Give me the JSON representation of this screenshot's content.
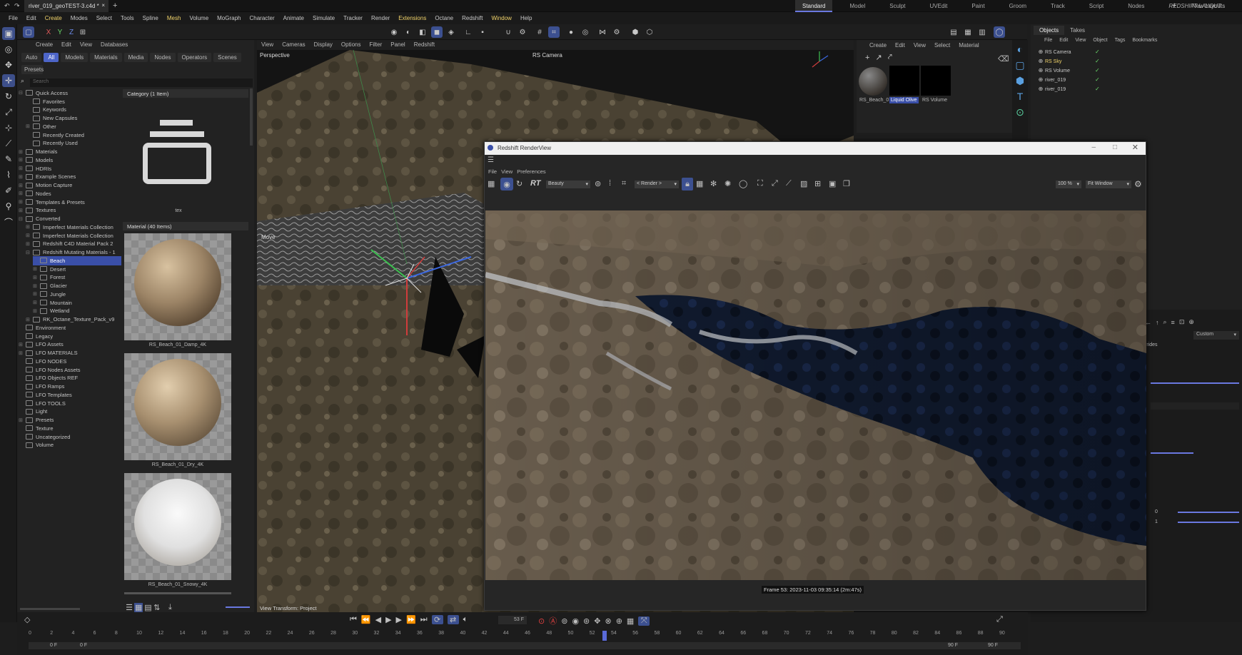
{
  "titlebar": {
    "tab": "river_019_geoTEST-3.c4d *",
    "layouts": [
      "Standard",
      "Model",
      "Sculpt",
      "UVEdit",
      "Paint",
      "Groom",
      "Track",
      "Script",
      "Nodes",
      "REDSHIFT-LAYOUT"
    ],
    "new_layouts": "New Layouts"
  },
  "menu": [
    "File",
    "Edit",
    "Create",
    "Modes",
    "Select",
    "Tools",
    "Spline",
    "Mesh",
    "Volume",
    "MoGraph",
    "Character",
    "Animate",
    "Simulate",
    "Tracker",
    "Render",
    "Extensions",
    "Octane",
    "Redshift",
    "Window",
    "Help"
  ],
  "asset": {
    "menu": [
      "Create",
      "Edit",
      "View",
      "Databases"
    ],
    "filters": [
      "Auto",
      "All",
      "Models",
      "Materials",
      "Media",
      "Nodes",
      "Operators",
      "Scenes"
    ],
    "presets": "Presets",
    "search": "Search",
    "tree": [
      {
        "l": "Quick Access",
        "d": 0,
        "f": "-"
      },
      {
        "l": "Favorites",
        "d": 1
      },
      {
        "l": "Keywords",
        "d": 1
      },
      {
        "l": "New Capsules",
        "d": 1
      },
      {
        "l": "Other",
        "d": 1,
        "f": "+"
      },
      {
        "l": "Recently Created",
        "d": 1
      },
      {
        "l": "Recently Used",
        "d": 1
      },
      {
        "l": "Materials",
        "d": 0,
        "f": "+"
      },
      {
        "l": "Models",
        "d": 0,
        "f": "+"
      },
      {
        "l": "HDRIs",
        "d": 0,
        "f": "+"
      },
      {
        "l": "Example Scenes",
        "d": 0,
        "f": "+"
      },
      {
        "l": "Motion Capture",
        "d": 0,
        "f": "+"
      },
      {
        "l": "Nodes",
        "d": 0,
        "f": "+"
      },
      {
        "l": "Templates & Presets",
        "d": 0,
        "f": "+"
      },
      {
        "l": "Textures",
        "d": 0,
        "f": "+"
      },
      {
        "l": "Converted",
        "d": 0,
        "f": "-"
      },
      {
        "l": "Imperfect Materials Collection",
        "d": 1,
        "f": "+"
      },
      {
        "l": "Imperfect Materials Collection",
        "d": 1,
        "f": "+"
      },
      {
        "l": "Redshift C4D Material Pack 2",
        "d": 1,
        "f": "+"
      },
      {
        "l": "Redshift Mutating Materials - 1",
        "d": 1,
        "f": "-"
      },
      {
        "l": "Beach",
        "d": 2,
        "sel": true
      },
      {
        "l": "Desert",
        "d": 2,
        "f": "+"
      },
      {
        "l": "Forest",
        "d": 2,
        "f": "+"
      },
      {
        "l": "Glacier",
        "d": 2,
        "f": "+"
      },
      {
        "l": "Jungle",
        "d": 2,
        "f": "+"
      },
      {
        "l": "Mountain",
        "d": 2,
        "f": "+"
      },
      {
        "l": "Wetland",
        "d": 2,
        "f": "+"
      },
      {
        "l": "RK_Octane_Texture_Pack_v9",
        "d": 1,
        "f": "+"
      },
      {
        "l": "Environment",
        "d": 0
      },
      {
        "l": "Legacy",
        "d": 0
      },
      {
        "l": "LFO Assets",
        "d": 0,
        "f": "+"
      },
      {
        "l": "LFO MATERIALS",
        "d": 0,
        "f": "+"
      },
      {
        "l": "LFO NODES",
        "d": 0
      },
      {
        "l": "LFO Nodes Assets",
        "d": 0
      },
      {
        "l": "LFO Objects REF",
        "d": 0
      },
      {
        "l": "LFO Ramps",
        "d": 0
      },
      {
        "l": "LFO Templates",
        "d": 0
      },
      {
        "l": "LFO TOOLS",
        "d": 0
      },
      {
        "l": "Light",
        "d": 0
      },
      {
        "l": "Presets",
        "d": 0,
        "f": "+"
      },
      {
        "l": "Texture",
        "d": 0
      },
      {
        "l": "Uncategorized",
        "d": 0
      },
      {
        "l": "Volume",
        "d": 0
      }
    ],
    "category_header": "Category (1 Item)",
    "category_item": "tex",
    "material_header": "Material (40 Items)",
    "materials": [
      "RS_Beach_01_Damp_4K",
      "RS_Beach_01_Dry_4K",
      "RS_Beach_01_Snowy_4K"
    ]
  },
  "viewport": {
    "menu": [
      "View",
      "Cameras",
      "Display",
      "Options",
      "Filter",
      "Panel",
      "Redshift"
    ],
    "label": "Perspective",
    "camera": "RS Camera",
    "move": "Move",
    "transform": "View Transform: Project"
  },
  "matmgr": {
    "menu": [
      "Create",
      "Edit",
      "View",
      "Select",
      "Material"
    ],
    "items": [
      "RS_Beach_0",
      "Liquid Olive",
      "RS Volume"
    ]
  },
  "objects": {
    "tabs": [
      "Objects",
      "Takes"
    ],
    "menu": [
      "File",
      "Edit",
      "View",
      "Object",
      "Tags",
      "Bookmarks"
    ],
    "items": [
      "RS Camera",
      "RS Sky",
      "RS Volume",
      "river_019",
      "river_019"
    ]
  },
  "attr": {
    "custom": "Custom",
    "rides": "rrides",
    "v0": "0",
    "v1": "1"
  },
  "renderview": {
    "title": "Redshift RenderView",
    "menu": [
      "File",
      "View",
      "Preferences"
    ],
    "aov": "Beauty",
    "render": "< Render >",
    "zoom": "100 %",
    "fit": "Fit Window",
    "rt": "RT",
    "status": "Frame  53:  2023-11-03  09:35:14  (2m:47s)"
  },
  "timeline": {
    "frame": "53 F",
    "start": "0 F",
    "start2": "0 F",
    "end": "90 F",
    "end2": "90 F",
    "ticks": [
      "0",
      "2",
      "4",
      "6",
      "8",
      "10",
      "12",
      "14",
      "16",
      "18",
      "20",
      "22",
      "24",
      "26",
      "28",
      "30",
      "32",
      "34",
      "36",
      "38",
      "40",
      "42",
      "44",
      "46",
      "48",
      "50",
      "52",
      "54",
      "56",
      "58",
      "60",
      "62",
      "64",
      "66",
      "68",
      "70",
      "72",
      "74",
      "76",
      "78",
      "80",
      "82",
      "84",
      "86",
      "88",
      "90"
    ]
  }
}
